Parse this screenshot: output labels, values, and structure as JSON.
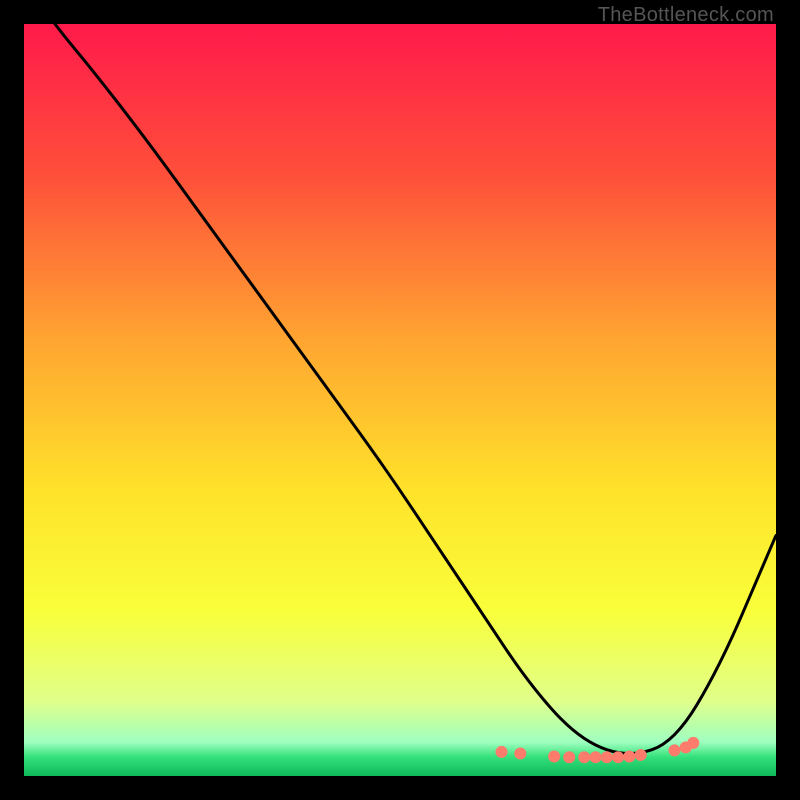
{
  "watermark": "TheBottleneck.com",
  "chart_data": {
    "type": "line",
    "title": "",
    "xlabel": "",
    "ylabel": "",
    "xlim": [
      0,
      100
    ],
    "ylim": [
      0,
      100
    ],
    "background_gradient": {
      "stops": [
        {
          "offset": 0.0,
          "color": "#ff1a4b"
        },
        {
          "offset": 0.2,
          "color": "#ff4f3a"
        },
        {
          "offset": 0.42,
          "color": "#ffa531"
        },
        {
          "offset": 0.62,
          "color": "#ffe22a"
        },
        {
          "offset": 0.78,
          "color": "#f9ff3a"
        },
        {
          "offset": 0.9,
          "color": "#e0ff8a"
        },
        {
          "offset": 0.955,
          "color": "#9fffc0"
        },
        {
          "offset": 0.975,
          "color": "#33e07a"
        },
        {
          "offset": 1.0,
          "color": "#0db95a"
        }
      ]
    },
    "series": [
      {
        "name": "bottleneck-curve",
        "color": "#000000",
        "x": [
          0,
          4,
          9,
          16,
          24,
          32,
          40,
          48,
          56,
          62,
          66,
          70,
          73,
          76,
          79,
          82,
          85,
          88,
          91,
          94,
          97,
          100
        ],
        "y": [
          106,
          100,
          94,
          85,
          74,
          63,
          52,
          41,
          29,
          20,
          14,
          9,
          6,
          4,
          3,
          3,
          4,
          7,
          12,
          18,
          25,
          32
        ]
      }
    ],
    "markers": {
      "color": "#ff7b6b",
      "radius": 6,
      "x": [
        63.5,
        66.0,
        70.5,
        72.5,
        74.5,
        76.0,
        77.5,
        79.0,
        80.5,
        82.0,
        86.5,
        88.0,
        89.0
      ],
      "y": [
        3.2,
        3.0,
        2.6,
        2.5,
        2.5,
        2.5,
        2.5,
        2.5,
        2.6,
        2.8,
        3.4,
        3.8,
        4.4
      ]
    }
  }
}
